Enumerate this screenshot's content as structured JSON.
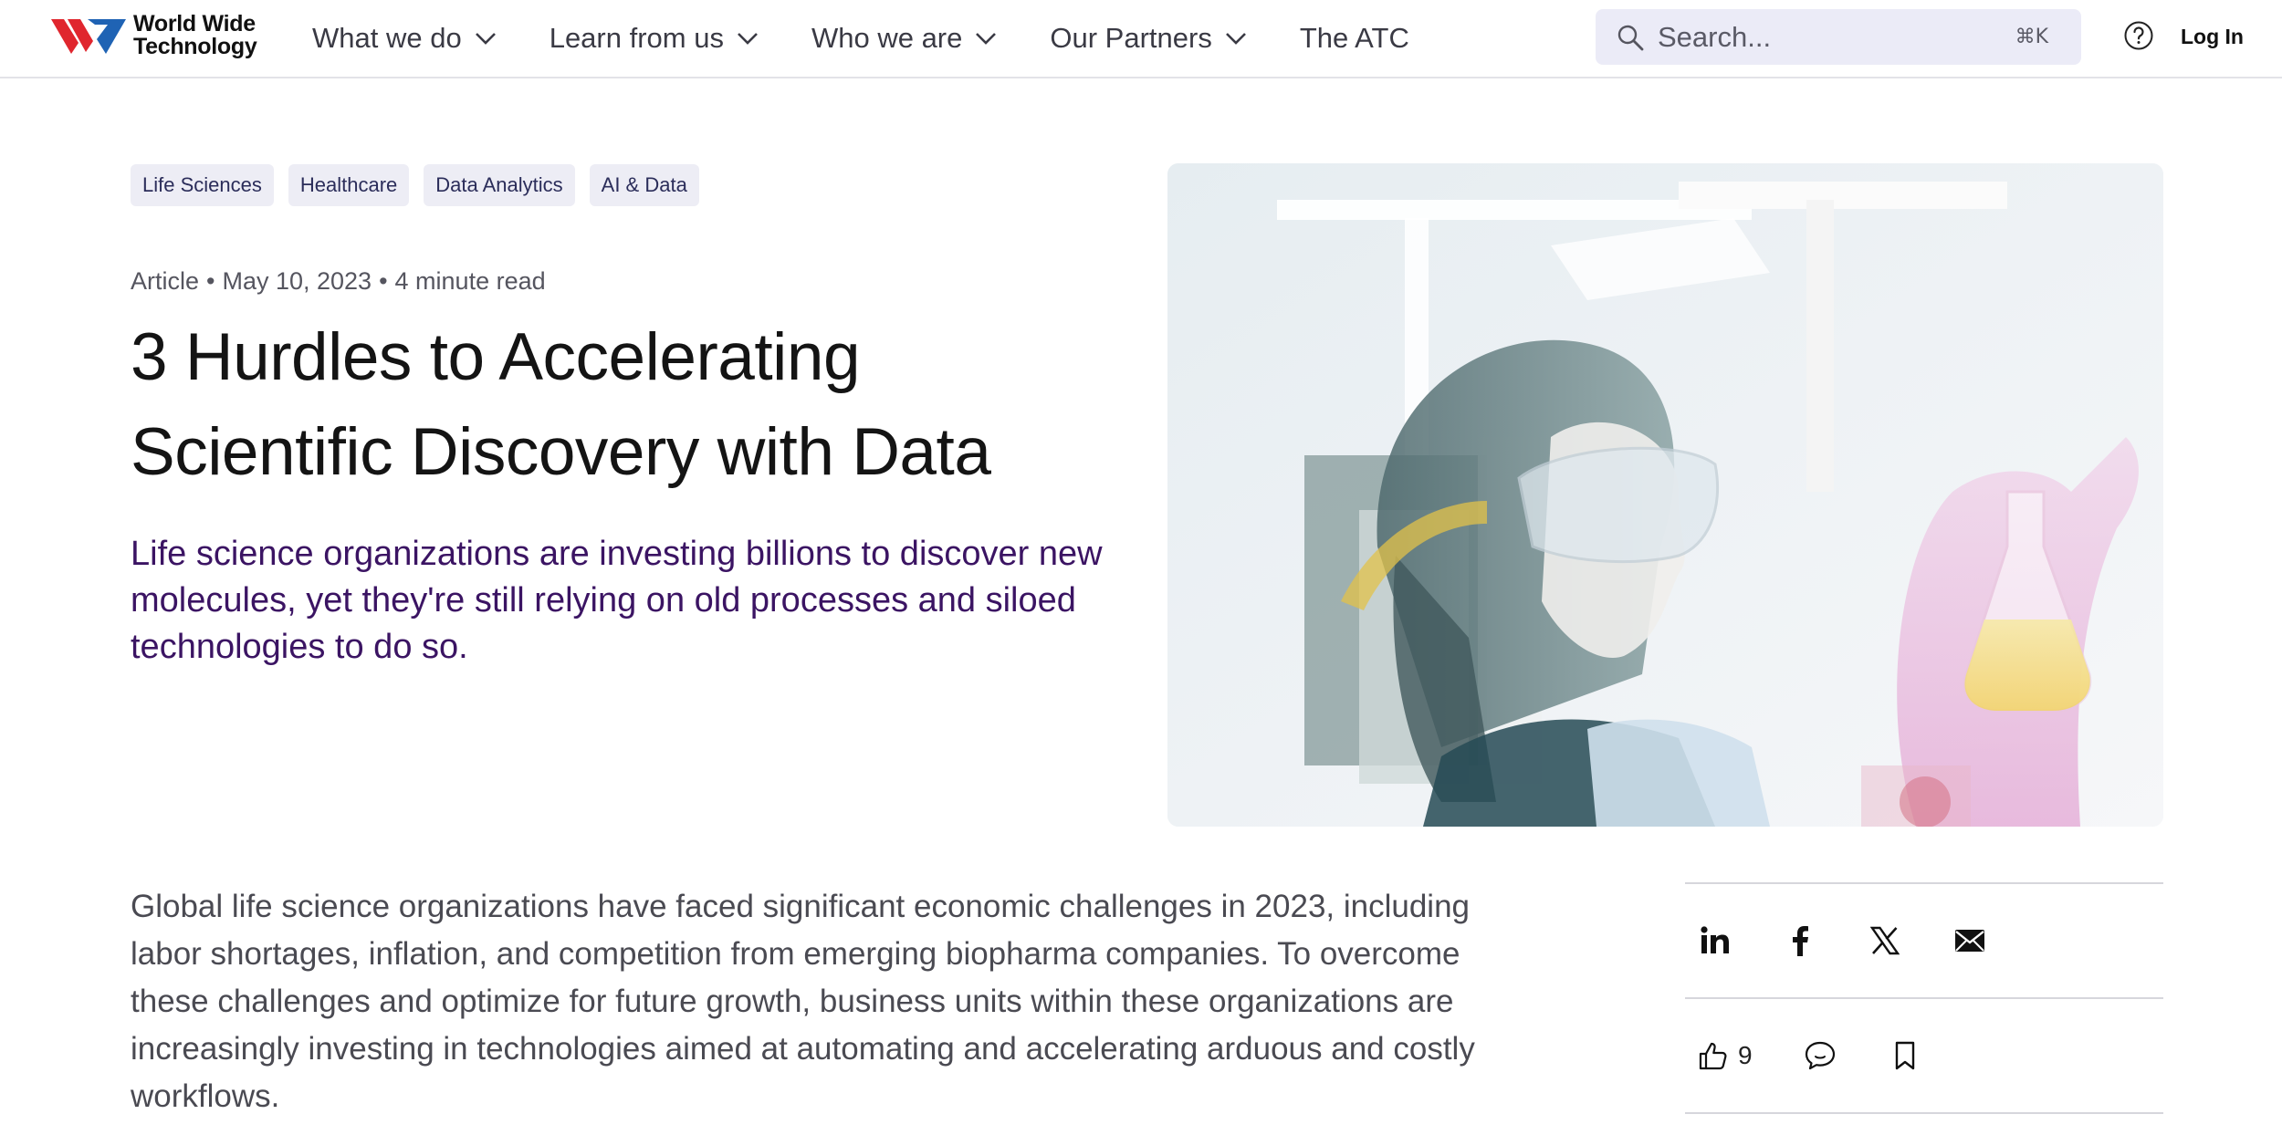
{
  "brand": {
    "name_line1": "World Wide",
    "name_line2": "Technology",
    "colors": {
      "red": "#e0262e",
      "blue": "#1f63b4"
    }
  },
  "nav": {
    "items": [
      {
        "label": "What we do",
        "has_dropdown": true
      },
      {
        "label": "Learn from us",
        "has_dropdown": true
      },
      {
        "label": "Who we are",
        "has_dropdown": true
      },
      {
        "label": "Our Partners",
        "has_dropdown": true
      },
      {
        "label": "The ATC",
        "has_dropdown": false
      }
    ]
  },
  "search": {
    "placeholder": "Search...",
    "shortcut": "⌘K",
    "icon": "search-icon"
  },
  "header_actions": {
    "help_icon": "help-circle-icon",
    "login_label": "Log In"
  },
  "article": {
    "tags": [
      "Life Sciences",
      "Healthcare",
      "Data Analytics",
      "AI & Data"
    ],
    "meta": {
      "type": "Article",
      "date": "May 10, 2023",
      "read_time": "4 minute read"
    },
    "title_line1": "3 Hurdles to Accelerating",
    "title_line2": "Scientific Discovery with Data",
    "lede": "Life science organizations are investing billions to discover new molecules, yet they're still relying on old processes and siloed technologies to do so.",
    "body": "Global life science organizations have faced significant economic challenges in 2023, including labor shortages, inflation, and competition from emerging biopharma companies. To overcome these challenges and optimize for future growth, business units within these organizations are increasingly investing in technologies aimed at automating and accelerating arduous and costly workflows."
  },
  "share": {
    "icons": [
      "linkedin-icon",
      "facebook-icon",
      "x-icon",
      "email-icon"
    ],
    "likes": "9",
    "actions": [
      "like-icon",
      "comment-icon",
      "bookmark-icon"
    ]
  },
  "colors": {
    "accent_text": "#3b1463",
    "tag_bg": "#ededf5",
    "search_bg": "#ebebf7"
  }
}
